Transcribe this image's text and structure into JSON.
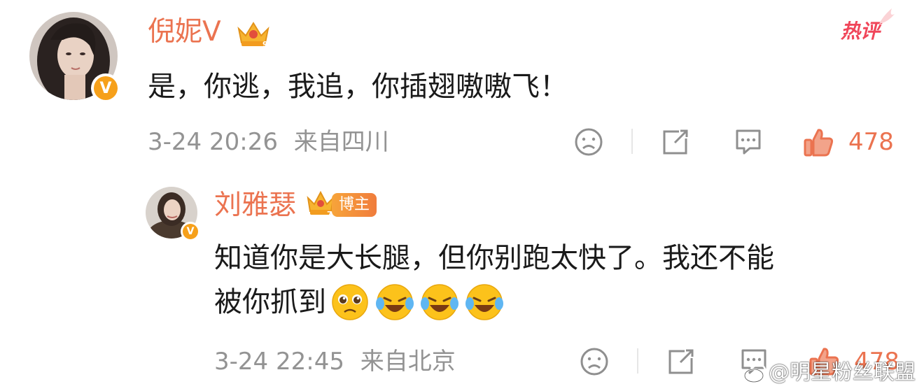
{
  "comment": {
    "username": "倪妮V",
    "hot_badge": "热评",
    "text": "是，你逃，我追，你插翅嗷嗷飞！",
    "timestamp": "3-24 20:26",
    "location": "来自四川",
    "like_count": "478",
    "icons": {
      "dislike": "sad-face-icon",
      "share": "share-icon",
      "comment": "comment-icon",
      "like": "thumbs-up-icon"
    }
  },
  "reply": {
    "username": "刘雅瑟",
    "role_badge": "博主",
    "text_line1": "知道你是大长腿，但你别跑太快了。我还不能",
    "text_line2": "被你抓到",
    "emojis": [
      "pleading-face-emoji",
      "laughing-crying-emoji",
      "laughing-crying-emoji",
      "laughing-crying-emoji"
    ],
    "timestamp": "3-24 22:45",
    "location": "来自北京",
    "like_count": "478"
  },
  "watermark": "@明星粉丝联盟",
  "colors": {
    "name": "#eb7350",
    "meta": "#939393",
    "hot": "#f0465a",
    "verified": "#f6a01a"
  }
}
